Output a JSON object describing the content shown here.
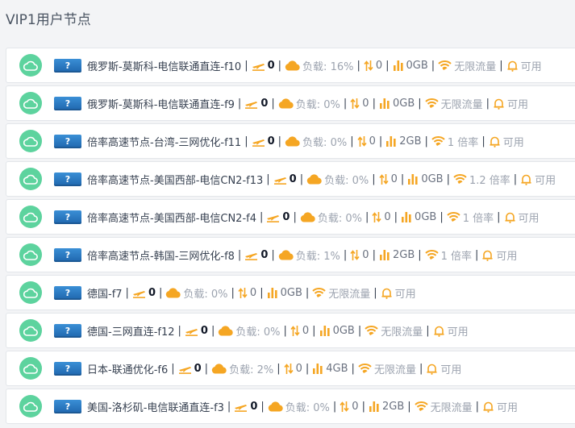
{
  "page": {
    "title": "VIP1用户节点"
  },
  "colors": {
    "orange": "#f5a623",
    "green_badge": "#5dd39e",
    "blue_badge": "#2b7bc7"
  },
  "labels": {
    "load_prefix": "负载:",
    "separator": "|",
    "question_mark": "?"
  },
  "icons": {
    "node": "cloud-icon",
    "online": "plane-icon",
    "load": "cloud-icon",
    "speed": "arrows-updown-icon",
    "usage": "bar-chart-icon",
    "traffic": "wifi-icon",
    "status": "bell-icon"
  },
  "nodes": [
    {
      "name": "俄罗斯-莫斯科-电信联通直连-f10",
      "online": "0",
      "load": "16%",
      "speed": "0",
      "usage": "0GB",
      "traffic": "无限流量",
      "status": "可用"
    },
    {
      "name": "俄罗斯-莫斯科-电信联通直连-f9",
      "online": "0",
      "load": "0%",
      "speed": "0",
      "usage": "0GB",
      "traffic": "无限流量",
      "status": "可用"
    },
    {
      "name": "倍率高速节点-台湾-三网优化-f11",
      "online": "0",
      "load": "0%",
      "speed": "0",
      "usage": "2GB",
      "traffic": "1 倍率",
      "status": "可用"
    },
    {
      "name": "倍率高速节点-美国西部-电信CN2-f13",
      "online": "0",
      "load": "0%",
      "speed": "0",
      "usage": "0GB",
      "traffic": "1.2 倍率",
      "status": "可用"
    },
    {
      "name": "倍率高速节点-美国西部-电信CN2-f4",
      "online": "0",
      "load": "0%",
      "speed": "0",
      "usage": "0GB",
      "traffic": "1 倍率",
      "status": "可用"
    },
    {
      "name": "倍率高速节点-韩国-三网优化-f8",
      "online": "0",
      "load": "1%",
      "speed": "0",
      "usage": "2GB",
      "traffic": "1 倍率",
      "status": "可用"
    },
    {
      "name": "德国-f7",
      "online": "0",
      "load": "0%",
      "speed": "0",
      "usage": "0GB",
      "traffic": "无限流量",
      "status": "可用"
    },
    {
      "name": "德国-三网直连-f12",
      "online": "0",
      "load": "0%",
      "speed": "0",
      "usage": "0GB",
      "traffic": "无限流量",
      "status": "可用"
    },
    {
      "name": "日本-联通优化-f6",
      "online": "0",
      "load": "2%",
      "speed": "0",
      "usage": "4GB",
      "traffic": "无限流量",
      "status": "可用"
    },
    {
      "name": "美国-洛杉矶-电信联通直连-f3",
      "online": "0",
      "load": "0%",
      "speed": "0",
      "usage": "2GB",
      "traffic": "无限流量",
      "status": "可用"
    }
  ]
}
